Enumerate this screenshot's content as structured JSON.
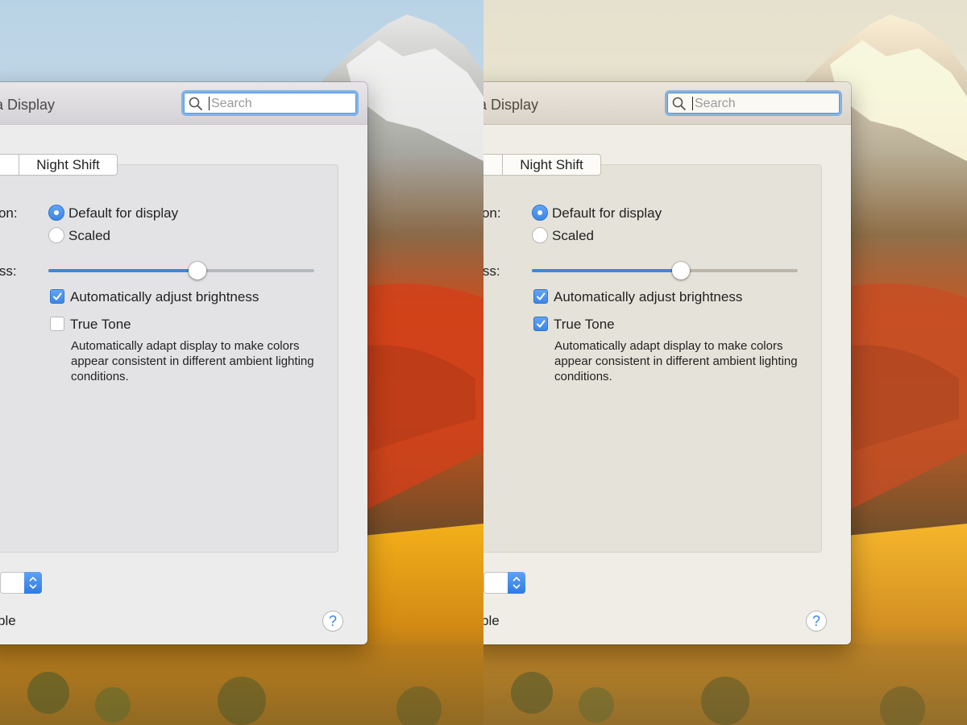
{
  "window": {
    "title_visible": "ina Display"
  },
  "search": {
    "placeholder": "Search"
  },
  "tabs": [
    {
      "label": "r"
    },
    {
      "label": "Night Shift"
    }
  ],
  "resolution": {
    "label_visible": "ution:",
    "options": [
      {
        "label": "Default for display",
        "selected": true
      },
      {
        "label": "Scaled",
        "selected": false
      }
    ]
  },
  "brightness": {
    "label_visible": "ness:",
    "level": 0.56
  },
  "auto_brightness": {
    "label": "Automatically adjust brightness",
    "checked": true
  },
  "true_tone": {
    "label": "True Tone",
    "description": "Automatically adapt display to make colors appear consistent in different ambient lighting conditions.",
    "checked_left": false,
    "checked_right": true
  },
  "airplay": {
    "label_visible": "ilable"
  },
  "help": {
    "label": "?"
  },
  "colors": {
    "accent": "#3b86e6"
  }
}
